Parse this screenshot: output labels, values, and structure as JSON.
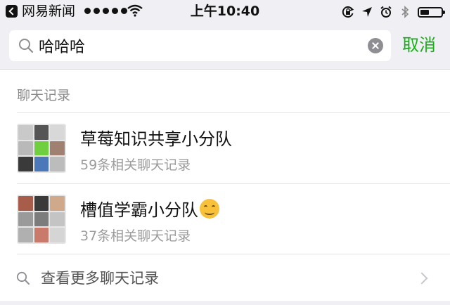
{
  "status_bar": {
    "app_name": "网易新闻",
    "time": "上午10:40",
    "icons": [
      "back-icon",
      "signal-dots-icon",
      "wifi-icon",
      "orientation-lock-icon",
      "location-icon",
      "alarm-icon",
      "bluetooth-icon",
      "battery-icon"
    ]
  },
  "search": {
    "query": "哈哈哈",
    "cancel_label": "取消",
    "icons": [
      "search-icon",
      "clear-icon"
    ]
  },
  "section": {
    "title": "聊天记录"
  },
  "results": [
    {
      "title": "草莓知识共享小分队",
      "subtitle": "59条相关聊天记录"
    },
    {
      "title": "槽值学霸小分队",
      "subtitle": "37条相关聊天记录",
      "emoji": "hugging-face-icon"
    }
  ],
  "more": {
    "label": "查看更多聊天记录",
    "icons": [
      "search-icon",
      "chevron-right-icon"
    ]
  },
  "colors": {
    "accent_green": "#1aad19",
    "bar_background": "#efeff4",
    "secondary_text": "#9b9b9b"
  }
}
